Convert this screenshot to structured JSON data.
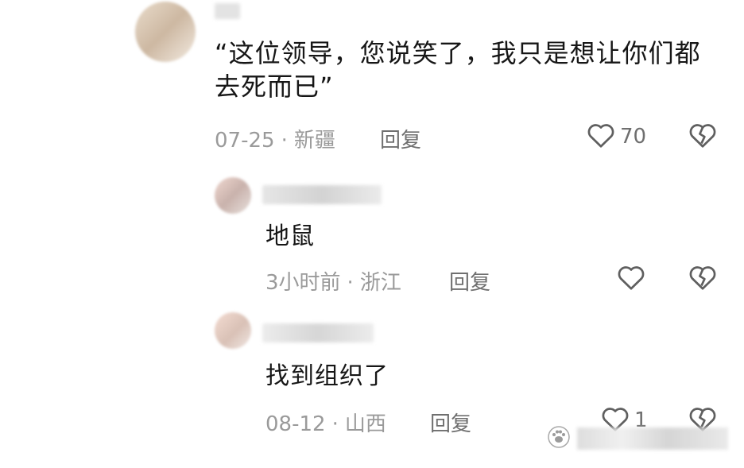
{
  "comments": [
    {
      "text": "“这位领导，您说笑了，我只是想让你们都去死而已”",
      "date": "07-25",
      "location": "新疆",
      "reply_label": "回复",
      "likes": "70"
    },
    {
      "text": "地鼠",
      "date": "3小时前",
      "location": "浙江",
      "reply_label": "回复",
      "likes": ""
    },
    {
      "text": "找到组织了",
      "date": "08-12",
      "location": "山西",
      "reply_label": "回复",
      "likes": "1"
    }
  ],
  "separator": "·",
  "icons": {
    "like": "heart-outline-icon",
    "dislike": "broken-heart-icon",
    "watermark": "paw-logo-icon"
  },
  "colors": {
    "text": "#161616",
    "meta": "#9a9a9a",
    "action": "#6f6f6f"
  }
}
